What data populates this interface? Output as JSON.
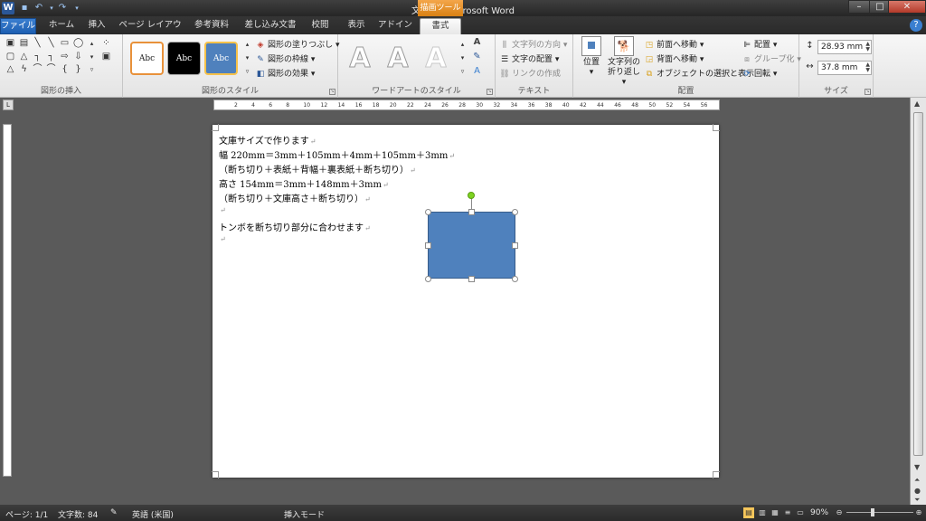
{
  "window": {
    "title": "文書 1 - Microsoft Word",
    "contextual_tool": "描画ツール",
    "controls": [
      "–",
      "□",
      "✕"
    ]
  },
  "tabs": {
    "file": "ファイル",
    "items": [
      "ホーム",
      "挿入",
      "ページ レイアウト",
      "参考資料",
      "差し込み文書",
      "校閲",
      "表示",
      "アドイン",
      "書式"
    ],
    "active": "書式",
    "help": "?"
  },
  "ribbon": {
    "insert_shapes": {
      "label": "図形の挿入"
    },
    "shape_styles": {
      "label": "図形のスタイル",
      "thumbs": [
        "Abc",
        "Abc",
        "Abc"
      ],
      "fill": "図形の塗りつぶし",
      "outline": "図形の枠線",
      "effects": "図形の効果"
    },
    "wordart": {
      "label": "ワードアートのスタイル",
      "letters": [
        "A",
        "A",
        "A"
      ]
    },
    "text": {
      "label": "テキスト",
      "direction": "文字列の方向",
      "align": "文字の配置",
      "link": "リンクの作成"
    },
    "arrange": {
      "label": "配置",
      "position": "位置",
      "wrap_line1": "文字列の",
      "wrap_line2": "折り返し",
      "bring_forward": "前面へ移動",
      "send_backward": "背面へ移動",
      "selection_pane": "オブジェクトの選択と表示",
      "align": "配置",
      "group": "グループ化",
      "rotate": "回転"
    },
    "size": {
      "label": "サイズ",
      "height": "28.93 mm",
      "width": "37.8 mm"
    }
  },
  "ruler": {
    "ticks": [
      "2",
      "4",
      "6",
      "8",
      "10",
      "12",
      "14",
      "16",
      "18",
      "20",
      "22",
      "24",
      "26",
      "28",
      "30",
      "32",
      "34",
      "36",
      "38",
      "40",
      "42",
      "44",
      "46",
      "48",
      "50",
      "52",
      "54",
      "56"
    ]
  },
  "document": {
    "lines": [
      "文庫サイズで作ります",
      "幅 220mm＝3mm＋105mm＋4mm＋105mm＋3mm",
      "（断ち切り＋表紙＋背幅＋裏表紙＋断ち切り）",
      "高さ 154mm＝3mm＋148mm＋3mm",
      "（断ち切り＋文庫高さ＋断ち切り）",
      "",
      "トンボを断ち切り部分に合わせます",
      ""
    ],
    "shape_color": "#4F81BD"
  },
  "status": {
    "page": "ページ: 1/1",
    "word_count": "文字数: 84",
    "language": "英語 (米国)",
    "mode": "挿入モード",
    "zoom": "90%"
  },
  "colors": {
    "accent": "#2B5797",
    "contextual": "#E8921E",
    "shape_fill": "#4F81BD"
  }
}
